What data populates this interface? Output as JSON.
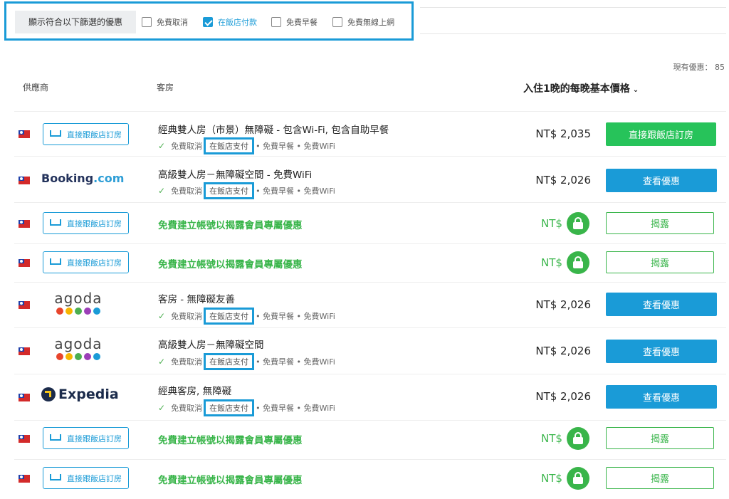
{
  "filters": {
    "label": "顯示符合以下篩選的優惠",
    "options": [
      {
        "label": "免費取消",
        "checked": false
      },
      {
        "label": "在飯店付款",
        "checked": true
      },
      {
        "label": "免費早餐",
        "checked": false
      },
      {
        "label": "免費無線上網",
        "checked": false
      }
    ]
  },
  "deal_count": "現有優惠： 85",
  "headers": {
    "provider": "供應商",
    "room": "客房",
    "price": "入住1晚的每晚基本價格"
  },
  "direct_label": "直接跟飯店訂房",
  "logos": {
    "booking_name": "Booking",
    "booking_dot": ".com",
    "agoda": "agoda",
    "expedia": "Expedia",
    "agoda_colors": [
      "#e8452c",
      "#f7b500",
      "#4caf50",
      "#9c3fb8",
      "#1a9bd7"
    ]
  },
  "perks": {
    "cancel": "免費取消",
    "pay_hotel": "在飯店支付",
    "rest": "• 免費早餐 • 免費WiFi"
  },
  "member_text": "免費建立帳號以揭露會員專屬優惠",
  "currency": "NT$",
  "buttons": {
    "direct": "直接跟飯店訂房",
    "view": "查看優惠",
    "reveal": "揭露"
  },
  "rows": [
    {
      "title": "經典雙人房（市景）無障礙 - 包含Wi-Fi, 包含自助早餐",
      "price": "NT$ 2,035"
    },
    {
      "title": "高級雙人房－無障礙空間 - 免費WiFi",
      "price": "NT$ 2,026"
    },
    {
      "title": "客房 - 無障礙友善",
      "price": "NT$ 2,026"
    },
    {
      "title": "高級雙人房－無障礙空間",
      "price": "NT$ 2,026"
    },
    {
      "title": "經典客房, 無障礙",
      "price": "NT$ 2,026"
    }
  ]
}
